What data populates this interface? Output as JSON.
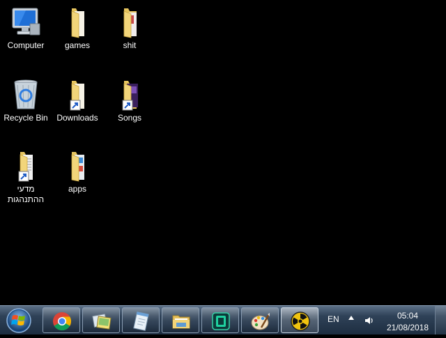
{
  "desktop": {
    "icons": [
      {
        "label": "Computer",
        "icon": "computer-icon"
      },
      {
        "label": "games",
        "icon": "folder-icon"
      },
      {
        "label": "shit",
        "icon": "folder-icon"
      },
      {
        "label": "Recycle Bin",
        "icon": "recycle-bin-icon"
      },
      {
        "label": "Downloads",
        "icon": "folder-shortcut-icon"
      },
      {
        "label": "Songs",
        "icon": "folder-shortcut-icon"
      },
      {
        "label": "מדעי ההתנהגות",
        "icon": "folder-shortcut-icon"
      },
      {
        "label": "apps",
        "icon": "folder-icon"
      }
    ]
  },
  "taskbar": {
    "start_icon": "windows-logo-icon",
    "pinned": [
      {
        "icon": "chrome-icon"
      },
      {
        "icon": "photos-icon"
      },
      {
        "icon": "notepad-icon"
      },
      {
        "icon": "file-explorer-icon"
      },
      {
        "icon": "app-green-icon"
      },
      {
        "icon": "paint-icon"
      },
      {
        "icon": "radiation-icon",
        "active": true
      }
    ],
    "tray": {
      "language": "EN",
      "time": "05:04",
      "date": "21/08/2018"
    }
  },
  "colors": {
    "desktop_bg": "#000000",
    "folder_yellow": "#f2d57a",
    "taskbar_top": "#5b6f86",
    "taskbar_bottom": "#1d2d40"
  }
}
